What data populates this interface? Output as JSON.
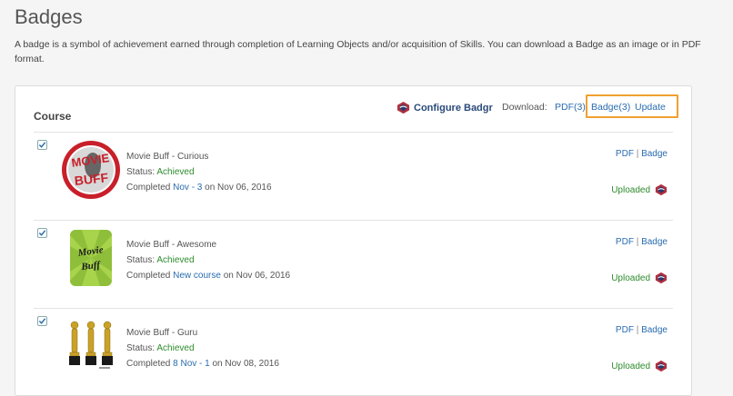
{
  "page": {
    "title": "Badges",
    "description": "A badge is a symbol of achievement earned through completion of Learning Objects and/or acquisition of Skills. You can download a Badge as an image or in PDF format."
  },
  "toolbar": {
    "configure_label": "Configure Badgr",
    "download_label": "Download:",
    "pdf_label": "PDF(3)",
    "badge_label": "Badge(3)",
    "update_label": "Update"
  },
  "section": {
    "title": "Course"
  },
  "badges": [
    {
      "name": "Movie Buff - Curious",
      "status_label": "Status:",
      "status": "Achieved",
      "completed_prefix": "Completed",
      "course_link": "Nov - 3",
      "completed_suffix": "on Nov 06, 2016",
      "pdf": "PDF",
      "badge": "Badge",
      "uploaded": "Uploaded",
      "checked": true
    },
    {
      "name": "Movie Buff - Awesome",
      "status_label": "Status:",
      "status": "Achieved",
      "completed_prefix": "Completed",
      "course_link": "New course",
      "completed_suffix": "on Nov 06, 2016",
      "pdf": "PDF",
      "badge": "Badge",
      "uploaded": "Uploaded",
      "checked": true
    },
    {
      "name": "Movie Buff - Guru",
      "status_label": "Status:",
      "status": "Achieved",
      "completed_prefix": "Completed",
      "course_link": "8 Nov - 1",
      "completed_suffix": "on Nov 08, 2016",
      "pdf": "PDF",
      "badge": "Badge",
      "uploaded": "Uploaded",
      "checked": true
    }
  ],
  "badge_art": {
    "curious_text_top": "MOVIE",
    "curious_text_bottom": "BUFF",
    "awesome_text_top": "Movie",
    "awesome_text_bottom": "Buff"
  },
  "colors": {
    "link": "#2a6cb0",
    "achieved": "#2e8b2e",
    "highlight": "#f0a030"
  }
}
